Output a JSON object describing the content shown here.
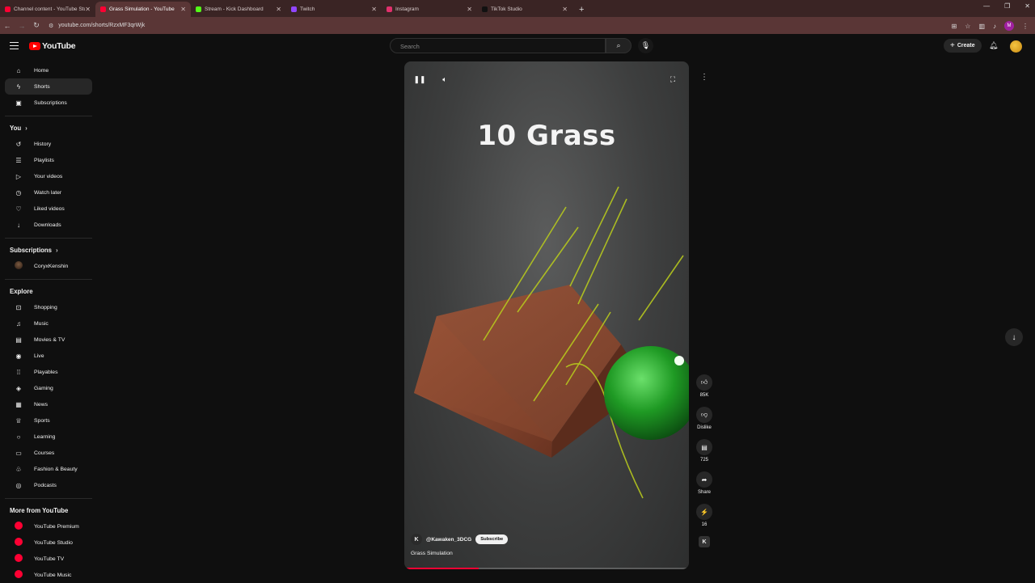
{
  "browser": {
    "tabs": [
      {
        "label": "Channel content - YouTube Stu",
        "color": "#ff0033"
      },
      {
        "label": "Grass Simulation - YouTube",
        "color": "#ff0033",
        "active": true
      },
      {
        "label": "Stream - Kick Dashboard",
        "color": "#53fc18"
      },
      {
        "label": "Twitch",
        "color": "#9146ff"
      },
      {
        "label": "Instagram",
        "color": "#e1306c"
      },
      {
        "label": "TikTok Studio",
        "color": "#111111"
      }
    ],
    "url": "youtube.com/shorts/RzxMF3qrWjk",
    "profile_initial": "M"
  },
  "masthead": {
    "logo_text": "YouTube",
    "search_placeholder": "Search",
    "create_label": "Create"
  },
  "sidebar": {
    "main": [
      {
        "label": "Home",
        "icon": "home-icon",
        "glyph": "⌂"
      },
      {
        "label": "Shorts",
        "icon": "shorts-icon",
        "glyph": "ϟ",
        "active": true
      },
      {
        "label": "Subscriptions",
        "icon": "subscriptions-icon",
        "glyph": "▣"
      }
    ],
    "you_heading": "You",
    "you": [
      {
        "label": "History",
        "icon": "history-icon",
        "glyph": "↺"
      },
      {
        "label": "Playlists",
        "icon": "playlists-icon",
        "glyph": "☰"
      },
      {
        "label": "Your videos",
        "icon": "your-videos-icon",
        "glyph": "▷"
      },
      {
        "label": "Watch later",
        "icon": "watch-later-icon",
        "glyph": "◷"
      },
      {
        "label": "Liked videos",
        "icon": "liked-videos-icon",
        "glyph": "♡"
      },
      {
        "label": "Downloads",
        "icon": "downloads-icon",
        "glyph": "↓"
      }
    ],
    "subscriptions_heading": "Subscriptions",
    "subscriptions": [
      {
        "label": "CoryxKenshin"
      }
    ],
    "explore_heading": "Explore",
    "explore": [
      {
        "label": "Shopping",
        "icon": "shopping-icon",
        "glyph": "⊡"
      },
      {
        "label": "Music",
        "icon": "music-icon",
        "glyph": "♫"
      },
      {
        "label": "Movies & TV",
        "icon": "movies-icon",
        "glyph": "▤"
      },
      {
        "label": "Live",
        "icon": "live-icon",
        "glyph": "◉"
      },
      {
        "label": "Playables",
        "icon": "playables-icon",
        "glyph": "⁞⁞"
      },
      {
        "label": "Gaming",
        "icon": "gaming-icon",
        "glyph": "◈"
      },
      {
        "label": "News",
        "icon": "news-icon",
        "glyph": "▦"
      },
      {
        "label": "Sports",
        "icon": "sports-icon",
        "glyph": "♕"
      },
      {
        "label": "Learning",
        "icon": "learning-icon",
        "glyph": "○"
      },
      {
        "label": "Courses",
        "icon": "courses-icon",
        "glyph": "▭"
      },
      {
        "label": "Fashion & Beauty",
        "icon": "fashion-icon",
        "glyph": "♧"
      },
      {
        "label": "Podcasts",
        "icon": "podcasts-icon",
        "glyph": "◎"
      }
    ],
    "more_heading": "More from YouTube",
    "more": [
      {
        "label": "YouTube Premium"
      },
      {
        "label": "YouTube Studio"
      },
      {
        "label": "YouTube TV"
      },
      {
        "label": "YouTube Music"
      }
    ]
  },
  "video": {
    "overlay_title": "10 Grass",
    "channel_initial": "K",
    "channel": "@Kawaken_3DCG",
    "subscribe_label": "Subscribe",
    "title": "Grass Simulation",
    "progress": 0.26
  },
  "actions": {
    "likes": "85K",
    "dislike_label": "Dislike",
    "comments": "725",
    "share_label": "Share",
    "remix_count": "16",
    "remix_initial": "K"
  }
}
